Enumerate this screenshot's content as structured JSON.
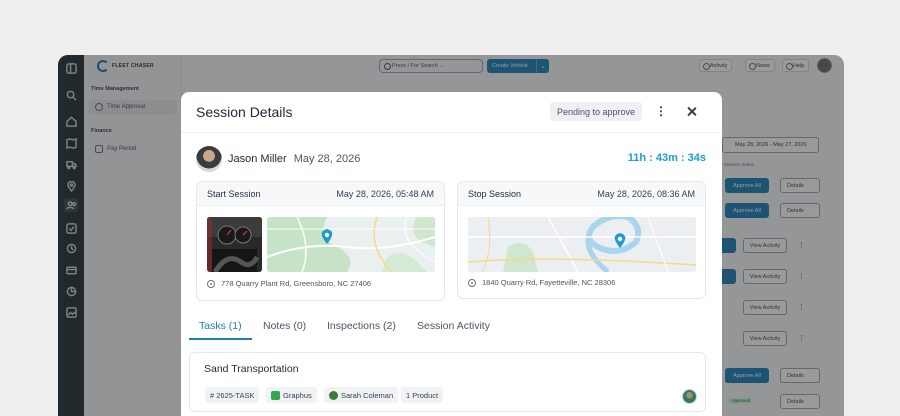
{
  "app": {
    "logo_text": "FLEET CHASER",
    "sidebar": {
      "sections": [
        {
          "title": "Time Management",
          "items": [
            {
              "label": "Time Approval",
              "active": true
            }
          ]
        },
        {
          "title": "Finance",
          "items": [
            {
              "label": "Pay Period",
              "active": false
            }
          ]
        }
      ]
    },
    "topbar": {
      "search_placeholder": "Press / For Search ...",
      "create_label": "Create Vehicle",
      "activity_label": "Activity",
      "news_label": "News",
      "help_label": "Help"
    },
    "background": {
      "date_range": "May 28, 2026 - May 27, 2026",
      "session_status_label": "Session Status",
      "approve_all_label": "Approve All",
      "details_label": "Details",
      "view_activity_label": "View Activity",
      "approved_label": "Approved"
    }
  },
  "modal": {
    "title": "Session Details",
    "status": "Pending to approve",
    "driver": {
      "name": "Jason Miller",
      "date": "May 28, 2026"
    },
    "duration": "11h : 43m : 34s",
    "start": {
      "label": "Start Session",
      "datetime": "May 28, 2026, 05:48 AM",
      "address": "778 Quarry Plant Rd, Greensboro, NC 27406"
    },
    "stop": {
      "label": "Stop Session",
      "datetime": "May 28, 2026, 08:36 AM",
      "address": "1840 Quarry Rd, Fayetteville, NC 28306"
    },
    "tabs": [
      {
        "label": "Tasks (1)",
        "active": true
      },
      {
        "label": "Notes (0)",
        "active": false
      },
      {
        "label": "Inspections (2)",
        "active": false
      },
      {
        "label": "Session Activity",
        "active": false
      }
    ],
    "task": {
      "title": "Sand Transportation",
      "chips": [
        "# 2625-TASK",
        "Graphus",
        "Sarah Coleman",
        "1 Product"
      ]
    }
  },
  "colors": {
    "accent": "#1d7fb8",
    "timer": "#1d9bd1",
    "rail": "#263238"
  }
}
